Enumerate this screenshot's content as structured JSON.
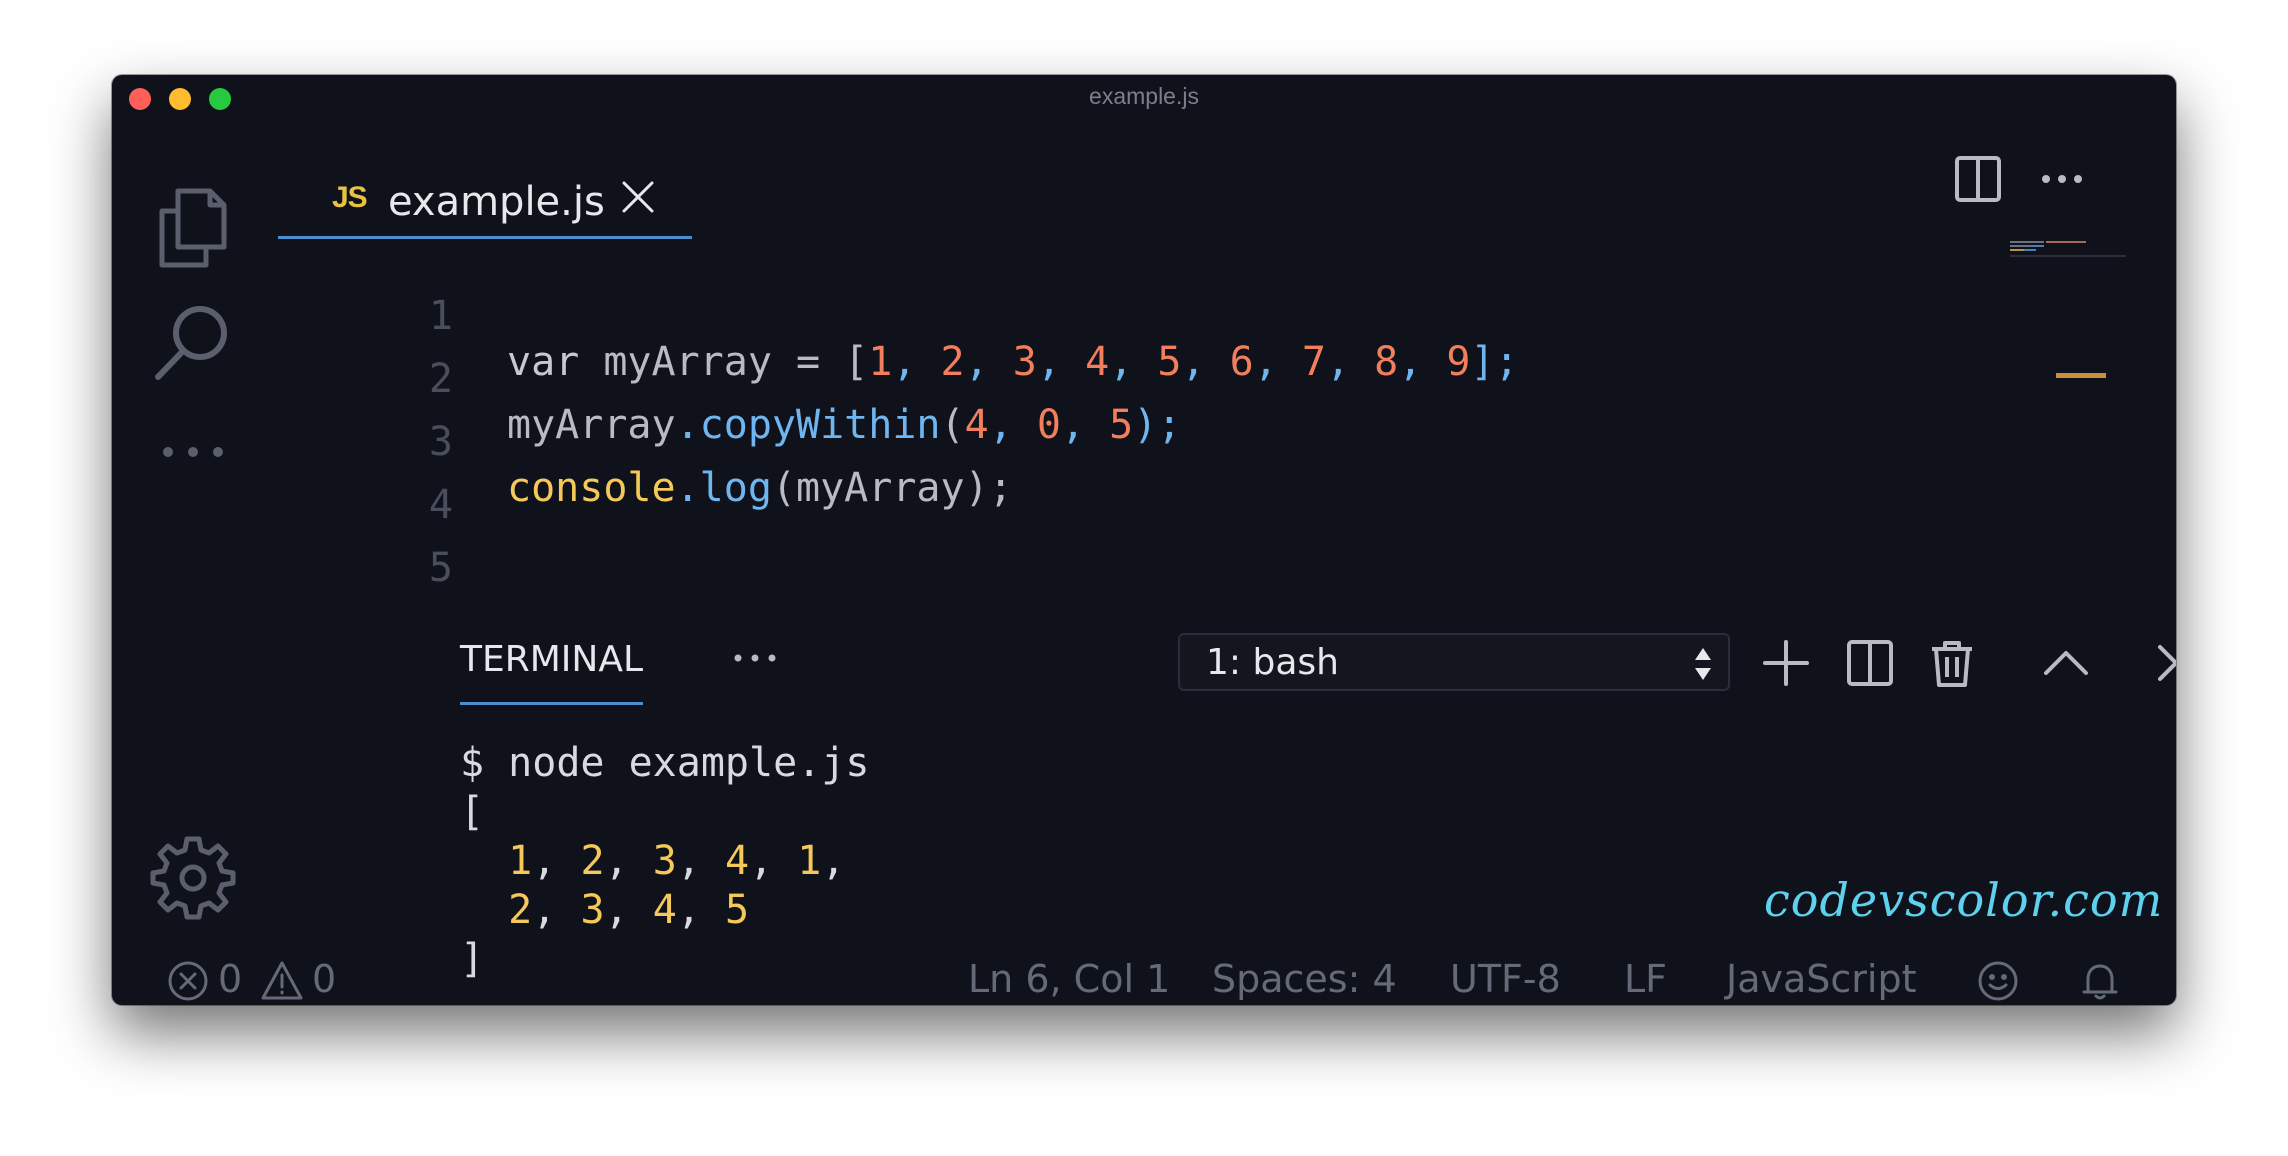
{
  "window": {
    "title": "example.js"
  },
  "tab": {
    "icon_label": "JS",
    "filename": "example.js"
  },
  "editor": {
    "lines": [
      {
        "number": "1"
      },
      {
        "number": "2"
      },
      {
        "number": "3"
      },
      {
        "number": "4"
      },
      {
        "number": "5"
      }
    ],
    "code": {
      "l1": [
        "var",
        " myArray ",
        "=",
        " [",
        "1",
        ", ",
        "2",
        ", ",
        "3",
        ", ",
        "4",
        ", ",
        "5",
        ", ",
        "6",
        ", ",
        "7",
        ", ",
        "8",
        ", ",
        "9",
        "];"
      ],
      "l2": [
        "myArray",
        ".",
        "copyWithin",
        "(",
        "4",
        ", ",
        "0",
        ", ",
        "5",
        ");"
      ],
      "l3": [
        "console",
        ".",
        "log",
        "(myArray);"
      ]
    }
  },
  "panel": {
    "tab_label": "TERMINAL",
    "terminal_select": "1: bash",
    "output": {
      "command": "$ node example.js",
      "open": "[",
      "row1": [
        "1",
        "2",
        "3",
        "4",
        "1"
      ],
      "row2": [
        "2",
        "3",
        "4",
        "5"
      ],
      "close": "]"
    }
  },
  "watermark": "codevscolor.com",
  "statusbar": {
    "errors": "0",
    "warnings": "0",
    "position": "Ln 6, Col 1",
    "spaces": "Spaces: 4",
    "encoding": "UTF-8",
    "eol": "LF",
    "language": "JavaScript"
  },
  "colors": {
    "background": "#10121b",
    "accent": "#4c8fd1",
    "number": "#f17e5c",
    "function": "#6fb6f0",
    "object": "#f5c85a",
    "watermark": "#5cd2ee"
  },
  "icons": {
    "activity": [
      "files-icon",
      "search-icon",
      "more-icon",
      "settings-gear-icon"
    ],
    "editor_actions": [
      "split-editor-icon",
      "more-actions-icon"
    ],
    "panel_actions": [
      "new-terminal-icon",
      "split-terminal-icon",
      "kill-terminal-icon",
      "maximize-panel-icon",
      "close-panel-icon"
    ],
    "status": [
      "error-icon",
      "warning-icon",
      "feedback-smiley-icon",
      "bell-icon"
    ]
  }
}
